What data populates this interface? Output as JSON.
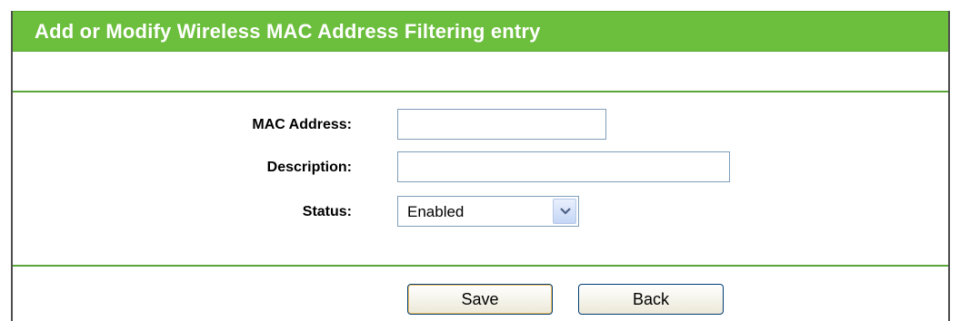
{
  "title": "Add or Modify Wireless MAC Address Filtering entry",
  "form": {
    "mac_address": {
      "label": "MAC Address:",
      "value": ""
    },
    "description": {
      "label": "Description:",
      "value": ""
    },
    "status": {
      "label": "Status:",
      "selected": "Enabled"
    }
  },
  "buttons": {
    "save": "Save",
    "back": "Back"
  },
  "colors": {
    "title_bar": "#6cbe3d",
    "divider": "#5aa53a",
    "input_border": "#7f9db9"
  },
  "icons": {
    "status_dropdown": "chevron-down-icon"
  }
}
